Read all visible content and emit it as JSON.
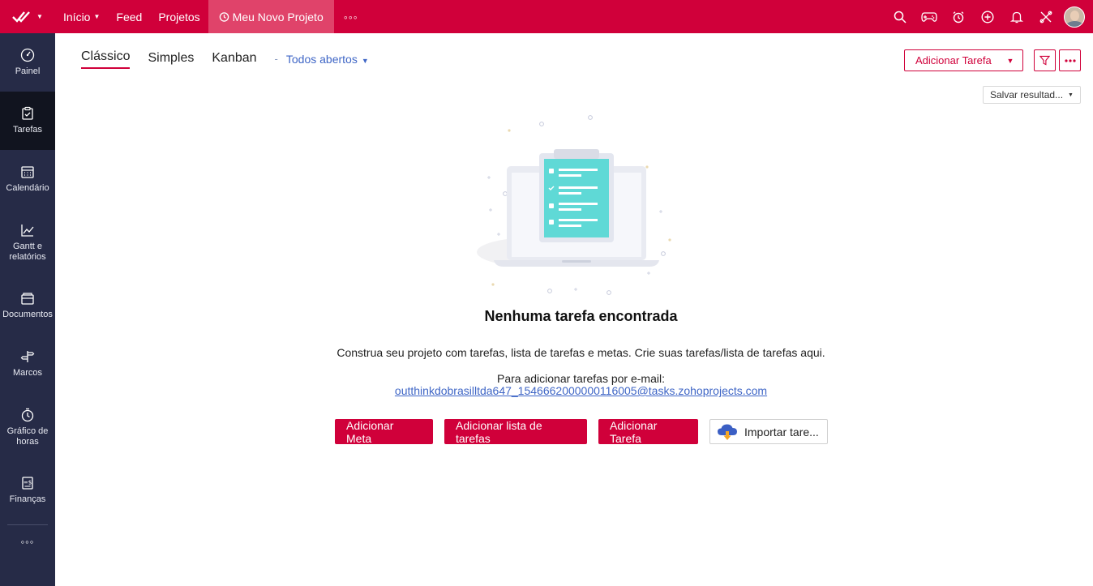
{
  "topbar": {
    "nav": [
      {
        "label": "Início",
        "has_caret": true
      },
      {
        "label": "Feed"
      },
      {
        "label": "Projetos"
      }
    ],
    "active_project": "Meu Novo Projeto",
    "more": "◦◦◦",
    "icons": [
      "search-icon",
      "gamepad-icon",
      "alarm-icon",
      "plus-circle-icon",
      "bell-icon",
      "tools-icon"
    ]
  },
  "sidebar": {
    "items": [
      {
        "label": "Painel",
        "icon": "dashboard-icon"
      },
      {
        "label": "Tarefas",
        "icon": "clipboard-icon",
        "active": true
      },
      {
        "label": "Calendário",
        "icon": "calendar-icon"
      },
      {
        "label": "Gantt e relatórios",
        "icon": "chart-icon"
      },
      {
        "label": "Documentos",
        "icon": "documents-icon"
      },
      {
        "label": "Marcos",
        "icon": "signpost-icon"
      },
      {
        "label": "Gráfico de horas",
        "icon": "timer-icon"
      },
      {
        "label": "Finanças",
        "icon": "finance-icon"
      }
    ],
    "more": "◦◦◦"
  },
  "main": {
    "views": [
      "Clássico",
      "Simples",
      "Kanban"
    ],
    "separator": "-",
    "filter": "Todos abertos",
    "add_task": "Adicionar Tarefa",
    "save_results": "Salvar resultad...",
    "empty_title": "Nenhuma tarefa encontrada",
    "empty_desc": "Construa seu projeto com tarefas, lista de tarefas e metas. Crie suas tarefas/lista de tarefas aqui.",
    "email_label": "Para adicionar tarefas por e-mail:",
    "email": "outthinkdobrasilltda647_1546662000000116005@tasks.zohoprojects.com",
    "actions": [
      "Adicionar Meta",
      "Adicionar lista de tarefas",
      "Adicionar Tarefa"
    ],
    "import": "Importar tare..."
  },
  "colors": {
    "brand": "#d0003a",
    "sidebar": "#262b47",
    "link": "#3f66c6",
    "illustration_accent": "#5fd9d6"
  }
}
